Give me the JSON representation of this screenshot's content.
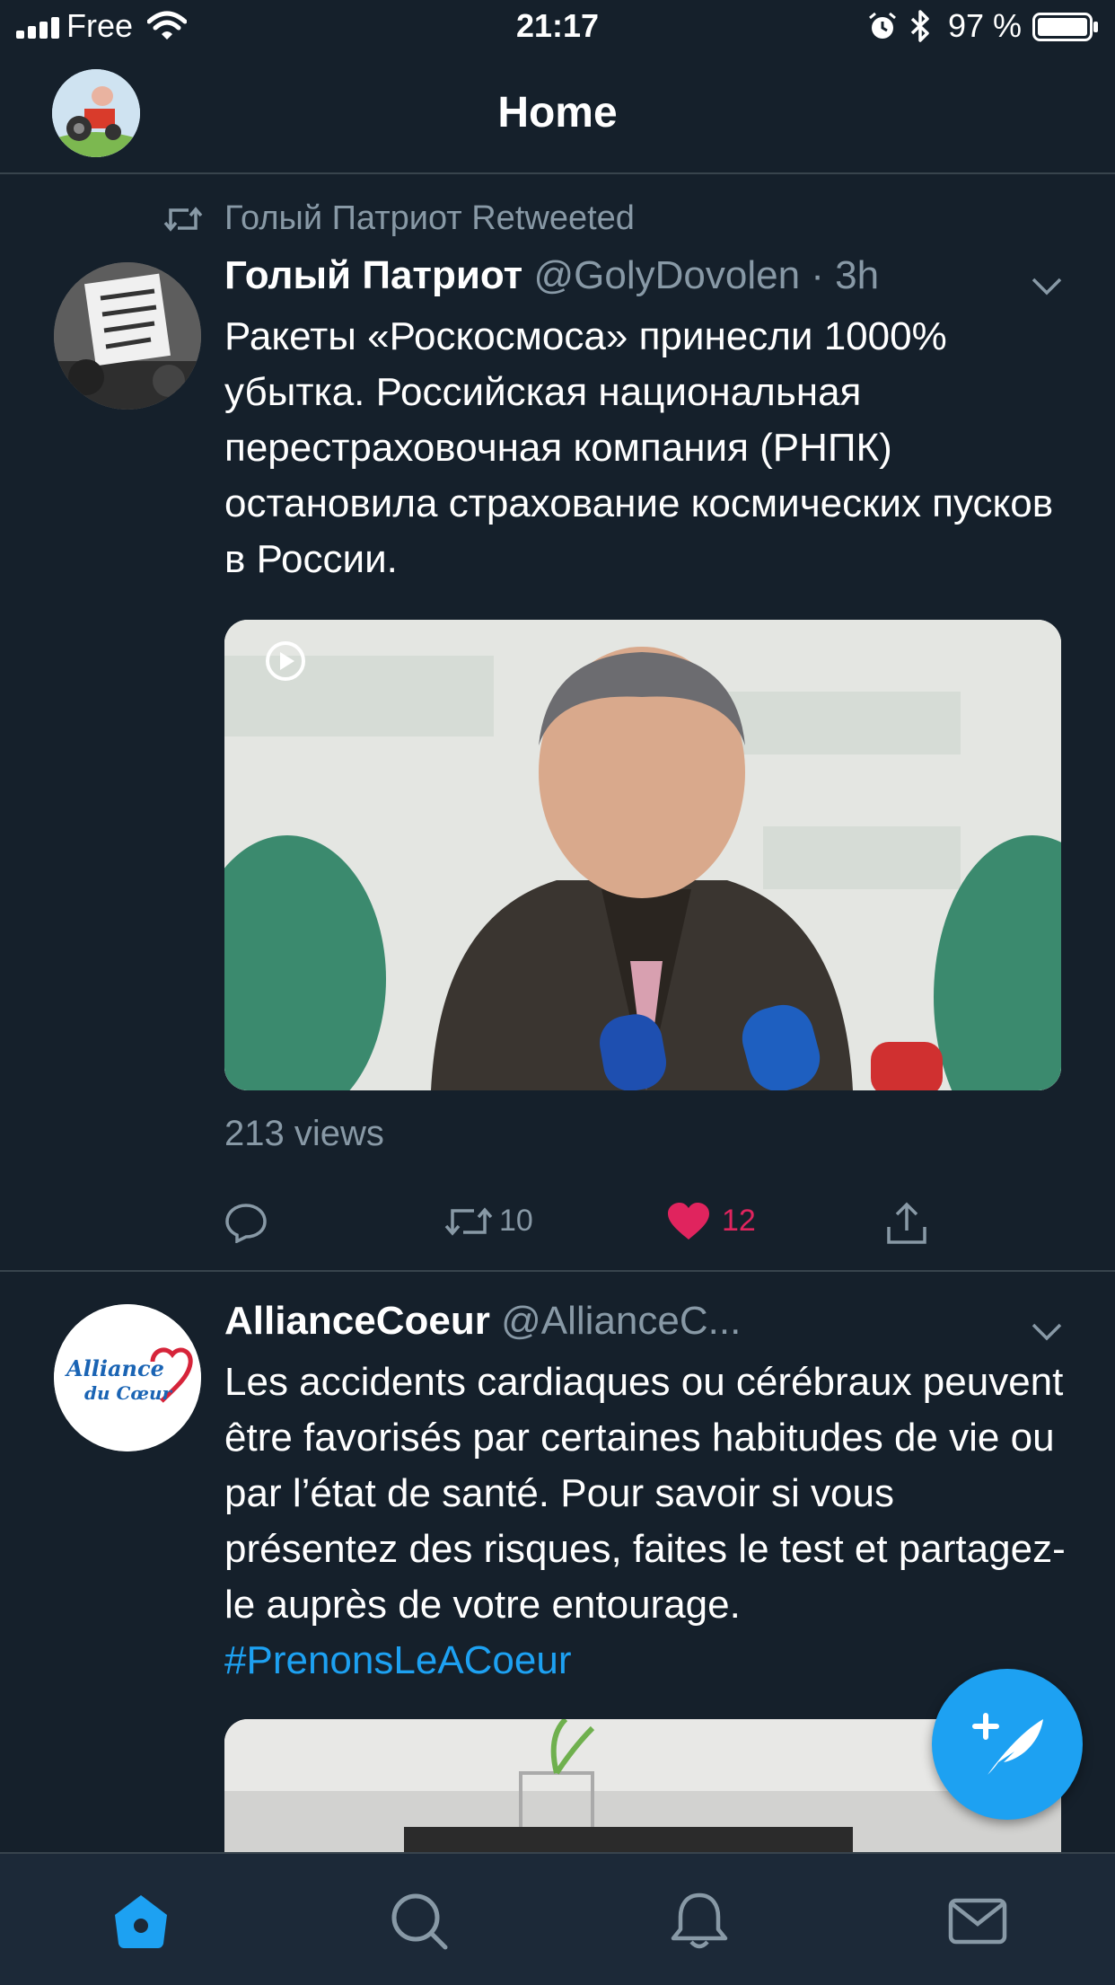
{
  "status_bar": {
    "carrier": "Free",
    "time": "21:17",
    "battery": "97 %"
  },
  "header": {
    "title": "Home"
  },
  "tweets": [
    {
      "retweeted_by": "Голый Патриот Retweeted",
      "name": "Голый Патриот",
      "handle": "@GolyDovolen",
      "time": "3h",
      "text": "Ракеты «Роскосмоса» принесли 1000% убытка. Российская национальная перестраховочная компания (РНПК) остановила страхование космических пусков в России.",
      "views": "213 views",
      "retweets": "10",
      "likes": "12",
      "liked": true
    },
    {
      "name": "AllianceCoeur",
      "handle": "@AllianceC...",
      "avatar_text": [
        "Alliance",
        "du Cœur"
      ],
      "text": "Les accidents cardiaques ou cérébraux peuvent être favorisés par certaines habitudes de vie ou par l’état de santé. Pour savoir si vous présentez des risques, faites le test et partagez-le auprès de votre entourage. ",
      "hashtag": "#PrenonsLeACoeur"
    }
  ],
  "tabs": [
    "home-icon",
    "search-icon",
    "notifications-icon",
    "messages-icon"
  ],
  "colors": {
    "background": "#15202b",
    "accent": "#1da1f2",
    "like": "#e0245e",
    "secondary_text": "#8899a6"
  }
}
